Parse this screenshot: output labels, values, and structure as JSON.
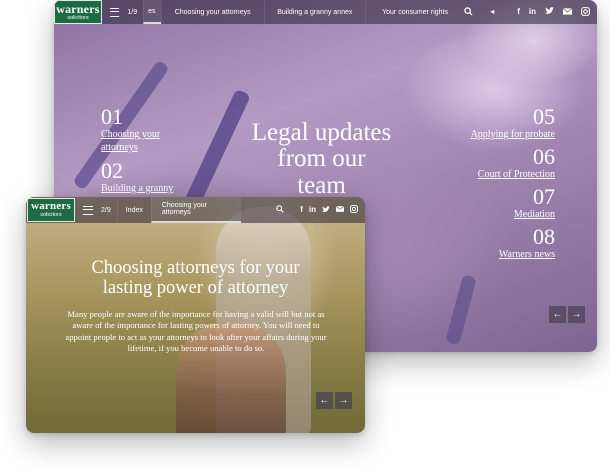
{
  "colors": {
    "brand_green": "#1d6b45",
    "nav_overlay": "#282234",
    "text": "#ffffff"
  },
  "back": {
    "logo": {
      "line1": "warners",
      "line2": "solicitors"
    },
    "pager": "1/9",
    "tabs": [
      {
        "label": "es"
      },
      {
        "label": "Choosing your attorneys"
      },
      {
        "label": "Building a granny annex"
      },
      {
        "label": "Your consumer rights"
      }
    ],
    "icons": [
      "search-icon",
      "sound-icon",
      "facebook-icon",
      "linkedin-icon",
      "twitter-icon",
      "email-icon",
      "instagram-icon"
    ],
    "title": [
      "Legal updates",
      "from our",
      "team"
    ],
    "left_items": [
      {
        "num": "01",
        "label_l1": "Choosing your",
        "label_l2": "attorneys"
      },
      {
        "num": "02",
        "label_l1": "Building a granny",
        "label_l2": ""
      }
    ],
    "right_items": [
      {
        "num": "05",
        "label": "Applying for probate"
      },
      {
        "num": "06",
        "label": "Court of Protection"
      },
      {
        "num": "07",
        "label": "Mediation"
      },
      {
        "num": "08",
        "label": "Warners news"
      }
    ]
  },
  "front": {
    "logo": {
      "line1": "warners",
      "line2": "solicitors"
    },
    "pager": "2/9",
    "tabs": [
      {
        "label": "Index"
      },
      {
        "label": "Choosing your attorneys"
      }
    ],
    "title_l1": "Choosing attorneys for your",
    "title_l2": "lasting power of attorney",
    "body": "Many people are aware of the importance for having a valid will but not as aware of the importance for lasting powers of attorney. You will need to appoint people to act as your attorneys to look after your affairs during your lifetime, if you become unable to do so."
  }
}
